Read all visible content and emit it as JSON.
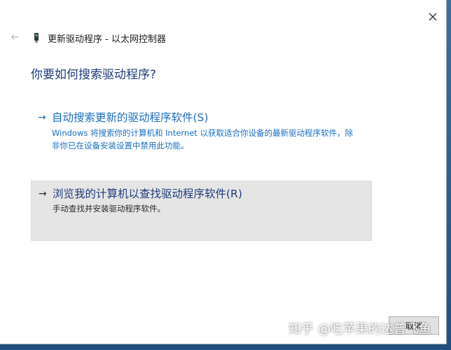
{
  "window": {
    "header_title": "更新驱动程序 - 以太网控制器",
    "heading": "你要如何搜索驱动程序?"
  },
  "icons": {
    "close": "close-icon",
    "back": "back-arrow-icon",
    "device": "network-device-icon",
    "option_arrow": "right-arrow-icon"
  },
  "options": [
    {
      "arrow": "→",
      "title": "自动搜索更新的驱动程序软件(S)",
      "desc_line1": "Windows 将搜索你的计算机和 Internet 以获取适合你设备的最新驱动程序软件，除",
      "desc_line2": "非你已在设备安装设置中禁用此功能。"
    },
    {
      "arrow": "→",
      "title": "浏览我的计算机以查找驱动程序软件(R)",
      "desc_line1": "手动查找并安装驱动程序软件。"
    }
  ],
  "footer": {
    "cancel_label": "取消"
  },
  "watermark": "知乎 @吃苹果的达普飞鱼",
  "colors": {
    "link_blue": "#1b6ec2",
    "heading_blue": "#1f3d7a",
    "selected_bg": "#e5e5e5"
  }
}
